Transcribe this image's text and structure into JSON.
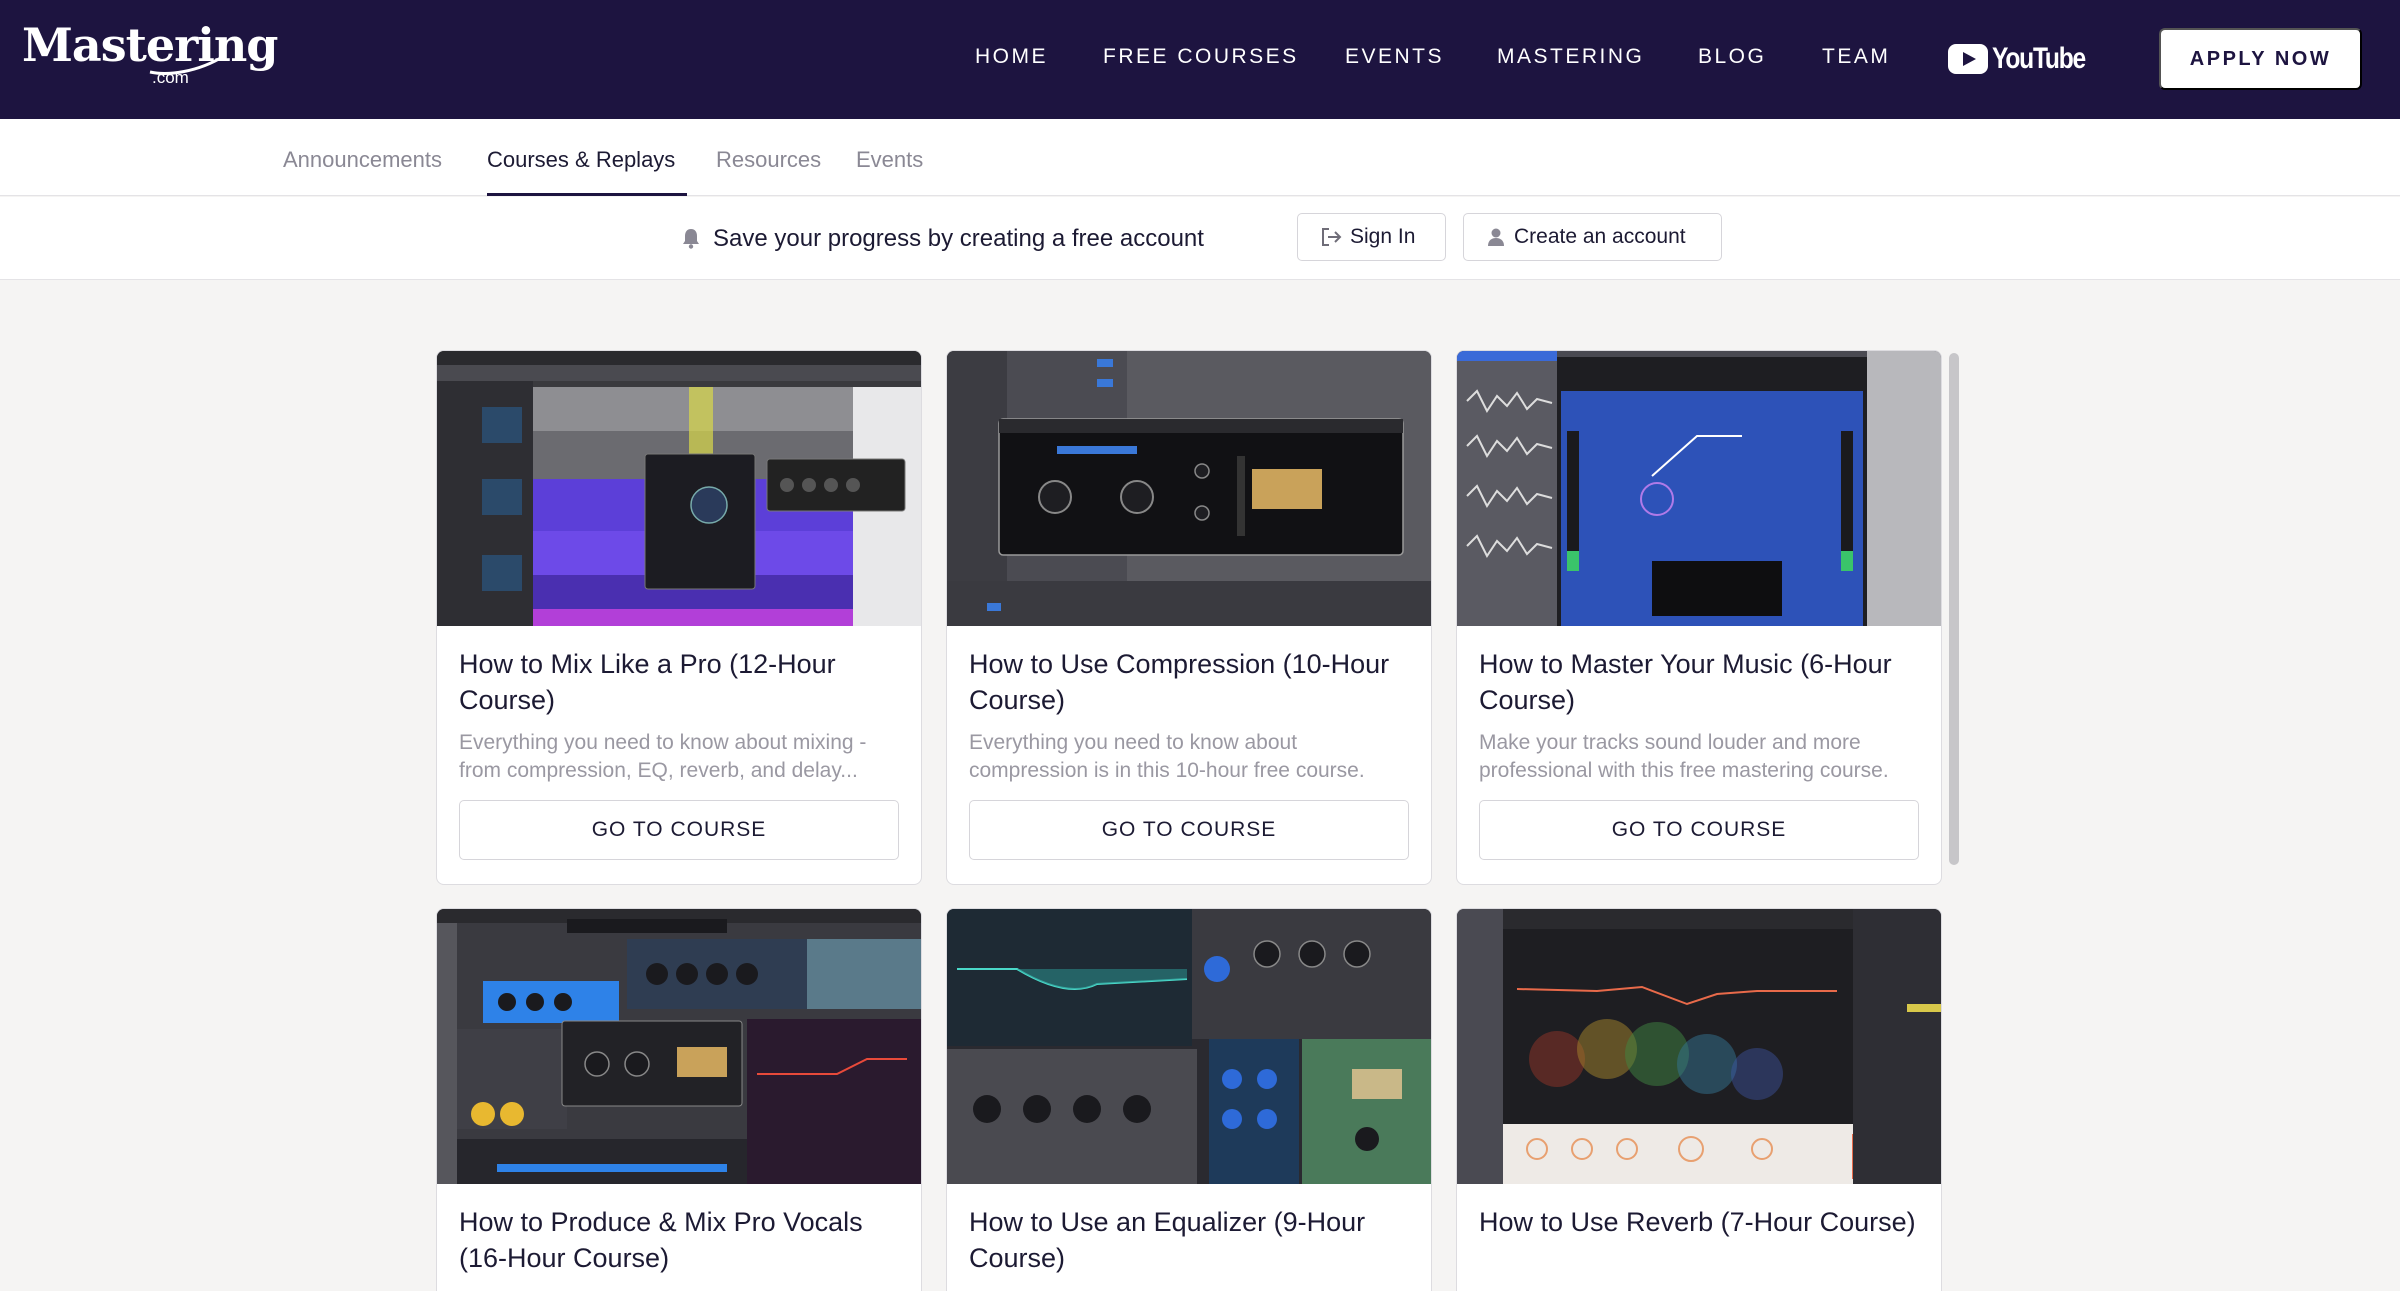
{
  "brand": {
    "logo": "Mastering",
    "logo_sub": ".com"
  },
  "nav": {
    "items": [
      "HOME",
      "FREE COURSES",
      "EVENTS",
      "MASTERING",
      "BLOG",
      "TEAM"
    ],
    "youtube_label": "YouTube",
    "apply_label": "APPLY NOW"
  },
  "subtabs": {
    "items": [
      "Announcements",
      "Courses & Replays",
      "Resources",
      "Events"
    ],
    "active": "Courses & Replays"
  },
  "banner": {
    "text": "Save your progress by creating a free account",
    "sign_in": "Sign In",
    "create_account": "Create an account"
  },
  "courses": [
    {
      "title": "How to Mix Like a Pro (12-Hour Course)",
      "desc": "Everything you need to know about mixing - from compression, EQ, reverb, and delay...",
      "button": "GO TO COURSE"
    },
    {
      "title": "How to Use Compression (10-Hour Course)",
      "desc": "Everything you need to know about compression is in this 10-hour free course.",
      "button": "GO TO COURSE"
    },
    {
      "title": "How to Master Your Music (6-Hour Course)",
      "desc": "Make your tracks sound louder and more professional with this free mastering course.",
      "button": "GO TO COURSE"
    },
    {
      "title": "How to Produce & Mix Pro Vocals (16-Hour Course)",
      "desc": "",
      "button": ""
    },
    {
      "title": "How to Use an Equalizer (9-Hour Course)",
      "desc": "",
      "button": ""
    },
    {
      "title": "How to Use Reverb (7-Hour Course)",
      "desc": "",
      "button": ""
    }
  ],
  "colors": {
    "nav_bg": "#1d1440",
    "page_bg": "#f5f4f3",
    "text": "#1c1a33",
    "muted": "#9a98a2"
  }
}
